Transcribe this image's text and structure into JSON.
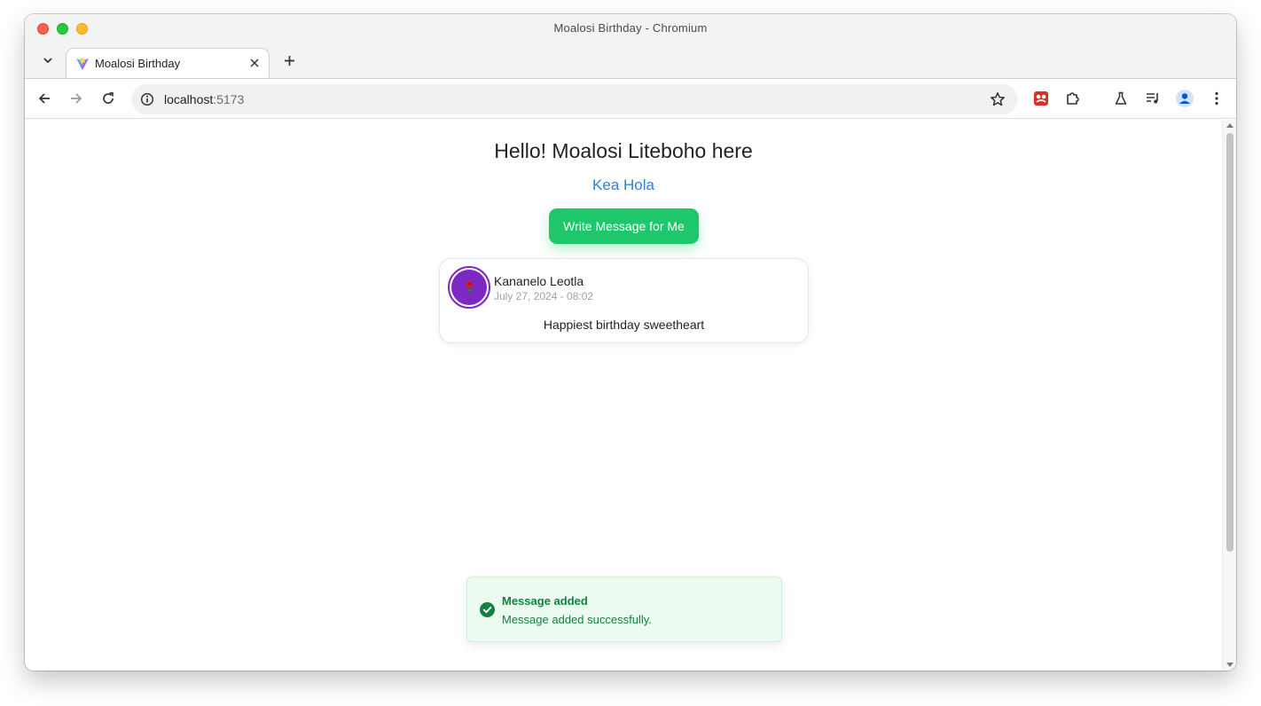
{
  "window": {
    "title": "Moalosi Birthday - Chromium"
  },
  "tabs": [
    {
      "label": "Moalosi Birthday",
      "active": true
    }
  ],
  "address_bar": {
    "host": "localhost",
    "port": ":5173"
  },
  "toolbar_icons": [
    "back-icon",
    "forward-icon",
    "reload-icon",
    "site-info-icon",
    "bookmark-star-icon",
    "extension-icon",
    "puzzle-extensions-icon",
    "labs-flask-icon",
    "media-queue-icon",
    "profile-icon",
    "more-menu-icon"
  ],
  "page": {
    "title": "Hello! Moalosi Liteboho here",
    "subtitle_link": "Kea Hola",
    "write_button": "Write Message for Me",
    "messages": [
      {
        "author": "Kananelo Leotla",
        "timestamp": "July 27, 2024 - 08:02",
        "body": "Happiest birthday sweetheart",
        "avatar_icon": "rose-icon"
      }
    ]
  },
  "toast": {
    "title": "Message added",
    "text": "Message added successfully."
  },
  "colors": {
    "primary_green": "#1dc76a",
    "link_blue": "#2f7fd8",
    "avatar_purple": "#7b28c4",
    "toast_bg": "#ebfbf0",
    "toast_text": "#13803f"
  }
}
